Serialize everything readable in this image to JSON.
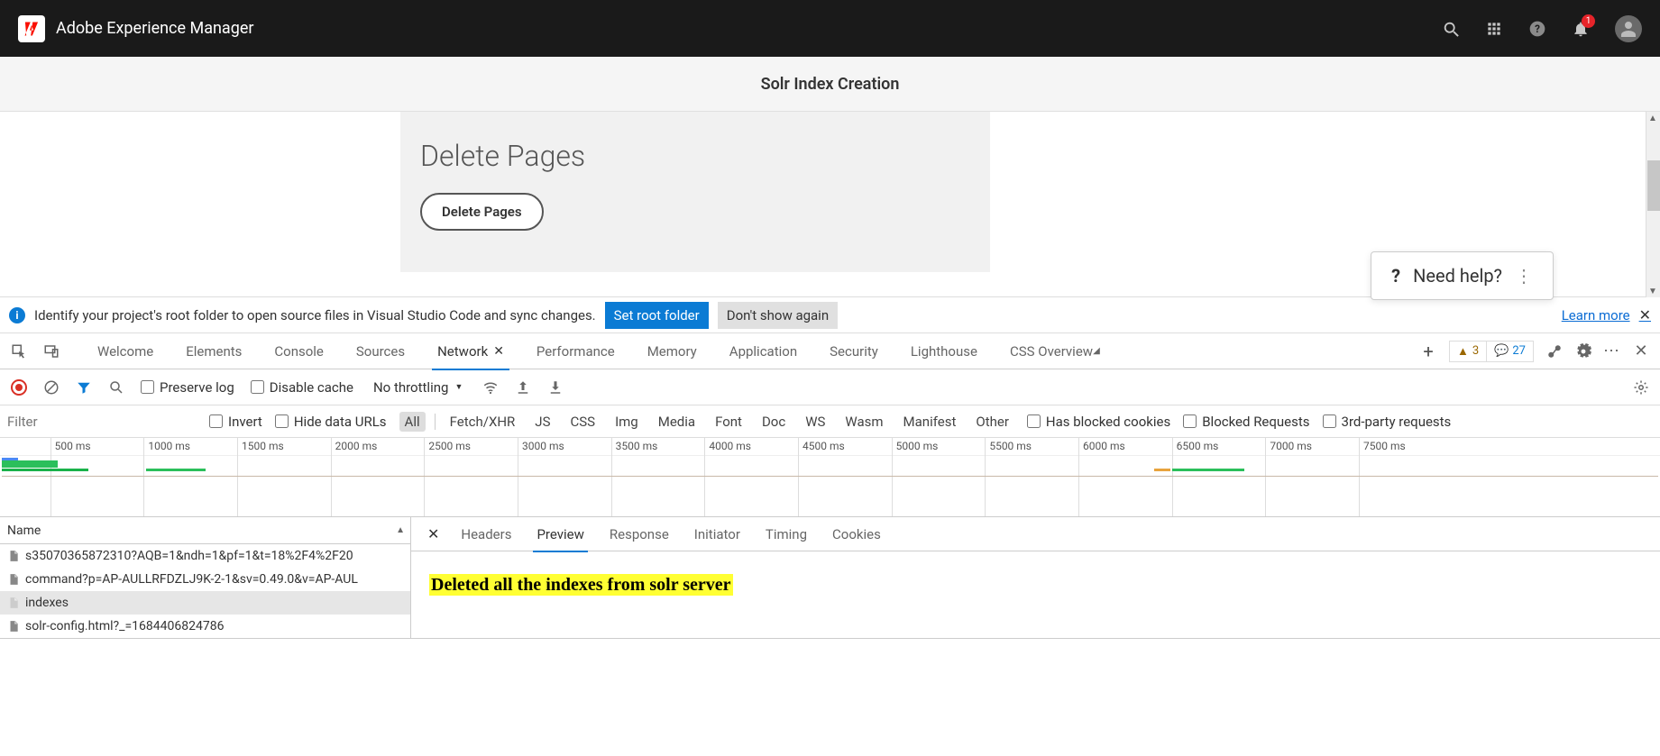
{
  "aem": {
    "title": "Adobe Experience Manager",
    "logo_letter": "A",
    "notif_count": "1"
  },
  "page": {
    "subtitle": "Solr Index Creation",
    "card_heading": "Delete Pages",
    "card_button": "Delete Pages",
    "need_help": "Need help?"
  },
  "vsbar": {
    "message": "Identify your project's root folder to open source files in Visual Studio Code and sync changes.",
    "set_root": "Set root folder",
    "dont_show": "Don't show again",
    "learn_more": "Learn more"
  },
  "devtools": {
    "tabs": [
      "Welcome",
      "Elements",
      "Console",
      "Sources",
      "Network",
      "Performance",
      "Memory",
      "Application",
      "Security",
      "Lighthouse",
      "CSS Overview"
    ],
    "active_tab": "Network",
    "warn_count": "3",
    "info_count": "27"
  },
  "net_toolbar": {
    "preserve_log": "Preserve log",
    "disable_cache": "Disable cache",
    "throttling": "No throttling"
  },
  "filter": {
    "placeholder": "Filter",
    "invert": "Invert",
    "hide_urls": "Hide data URLs",
    "types": [
      "All",
      "Fetch/XHR",
      "JS",
      "CSS",
      "Img",
      "Media",
      "Font",
      "Doc",
      "WS",
      "Wasm",
      "Manifest",
      "Other"
    ],
    "active_type": "All",
    "has_blocked": "Has blocked cookies",
    "blocked_req": "Blocked Requests",
    "third_party": "3rd-party requests"
  },
  "timeline": {
    "ticks": [
      "500 ms",
      "1000 ms",
      "1500 ms",
      "2000 ms",
      "2500 ms",
      "3000 ms",
      "3500 ms",
      "4000 ms",
      "4500 ms",
      "5000 ms",
      "5500 ms",
      "6000 ms",
      "6500 ms",
      "7000 ms",
      "7500 ms"
    ]
  },
  "requests": {
    "header": "Name",
    "rows": [
      {
        "name": "s35070365872310?AQB=1&ndh=1&pf=1&t=18%2F4%2F20",
        "selected": false,
        "light": false
      },
      {
        "name": "command?p=AP-AULLRFDZLJ9K-2-1&sv=0.49.0&v=AP-AUL",
        "selected": false,
        "light": false
      },
      {
        "name": "indexes",
        "selected": true,
        "light": true
      },
      {
        "name": "solr-config.html?_=1684406824786",
        "selected": false,
        "light": false
      }
    ]
  },
  "detail": {
    "tabs": [
      "Headers",
      "Preview",
      "Response",
      "Initiator",
      "Timing",
      "Cookies"
    ],
    "active": "Preview",
    "preview_text": "Deleted all the indexes from solr server"
  }
}
